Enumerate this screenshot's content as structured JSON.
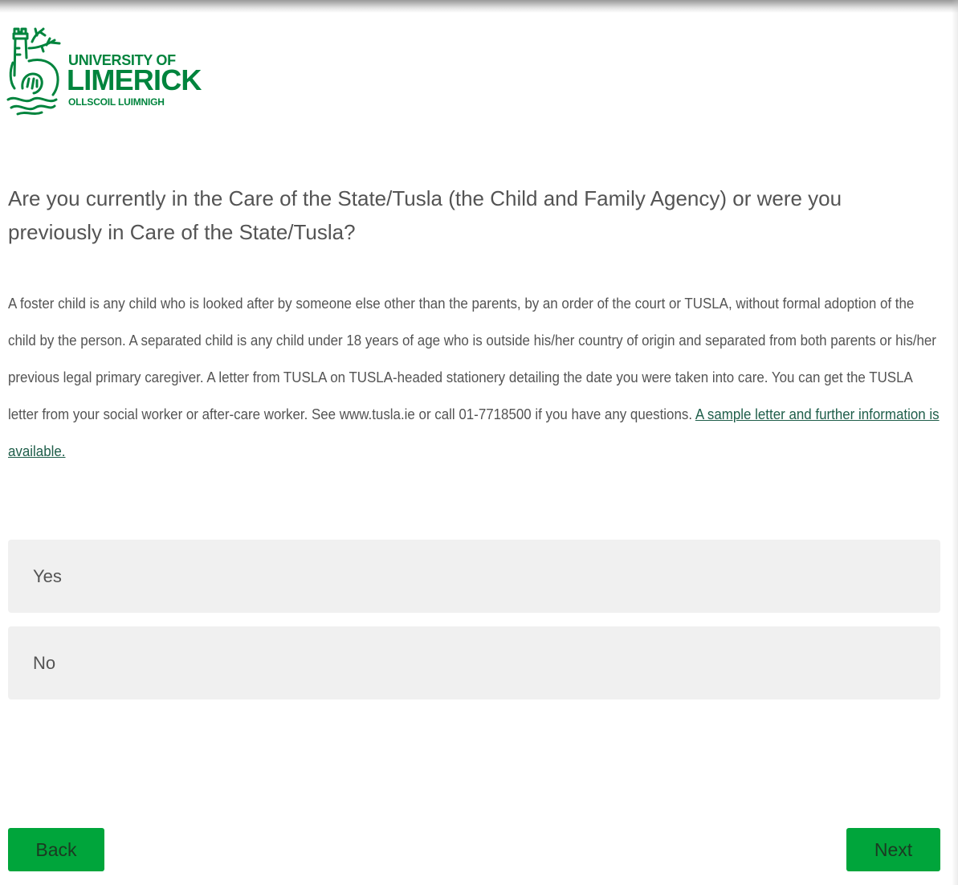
{
  "logo": {
    "line1": "UNIVERSITY OF",
    "line2": "LIMERICK",
    "line3": "OLLSCOIL LUIMNIGH",
    "icon": "ul-crest-icon"
  },
  "question": {
    "text": "Are you currently in the Care of the State/Tusla (the Child and Family Agency) or were you previously in Care of the State/Tusla?"
  },
  "description": {
    "text": "A foster child is any child who is looked after by someone else other than the parents, by an order of the court or TUSLA, without formal adoption of the child by the person. A separated child is any child under 18 years of age who is outside his/her country of origin and separated from both parents or his/her previous legal primary caregiver. A letter from TUSLA on TUSLA-headed stationery detailing the date you were taken into care. You can get the TUSLA letter from your social worker or after-care worker. See www.tusla.ie or call 01-7718500 if you have any questions.",
    "link_text": "A sample letter and further information is available."
  },
  "options": [
    {
      "label": "Yes"
    },
    {
      "label": "No"
    }
  ],
  "buttons": {
    "back": "Back",
    "next": "Next"
  },
  "colors": {
    "brand_green": "#00843d",
    "button_green": "#00a53b",
    "option_bg": "#f0f0f0",
    "text": "#545454",
    "link": "#1f5e4a"
  }
}
